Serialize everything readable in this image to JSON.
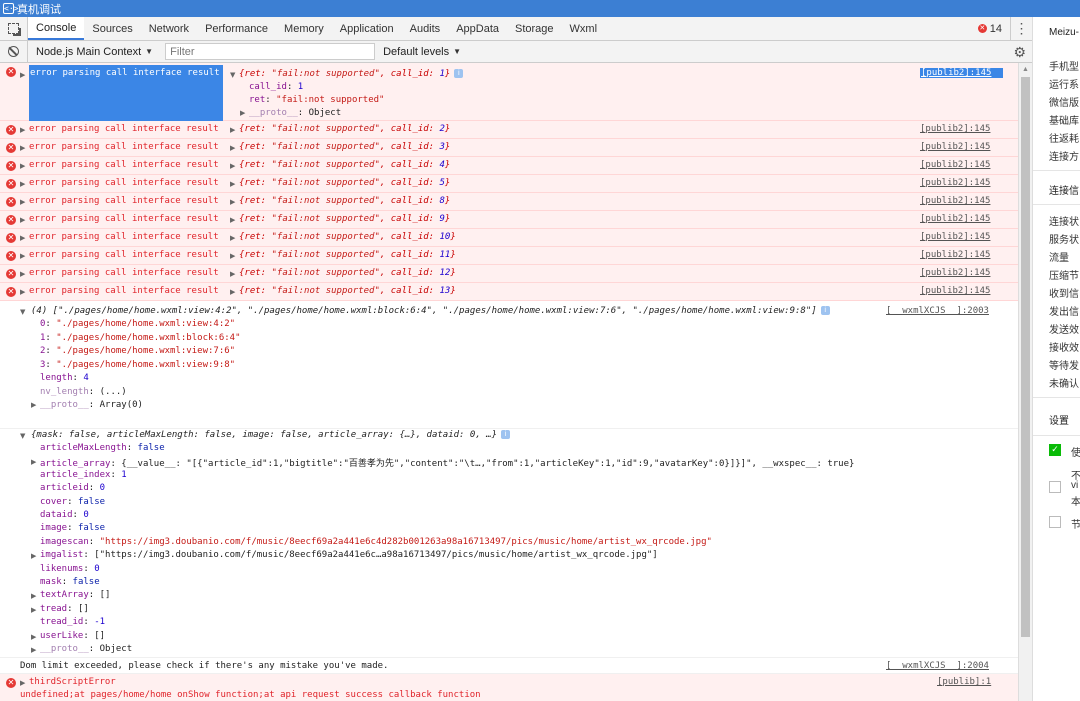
{
  "window": {
    "title": "真机调试",
    "icon": "<·>"
  },
  "tabs": [
    "Console",
    "Sources",
    "Network",
    "Performance",
    "Memory",
    "Application",
    "Audits",
    "AppData",
    "Storage",
    "Wxml"
  ],
  "error_count": "14",
  "filter": {
    "context": "Node.js Main Context",
    "placeholder": "Filter",
    "levels": "Default levels"
  },
  "errors": [
    {
      "msg": "error parsing call interface result",
      "ret": "\"fail:not supported\"",
      "call_id": "1",
      "source": "[publib2]:145"
    },
    {
      "msg": "error parsing call interface result",
      "ret": "\"fail:not supported\"",
      "call_id": "2",
      "source": "[publib2]:145"
    },
    {
      "msg": "error parsing call interface result",
      "ret": "\"fail:not supported\"",
      "call_id": "3",
      "source": "[publib2]:145"
    },
    {
      "msg": "error parsing call interface result",
      "ret": "\"fail:not supported\"",
      "call_id": "4",
      "source": "[publib2]:145"
    },
    {
      "msg": "error parsing call interface result",
      "ret": "\"fail:not supported\"",
      "call_id": "5",
      "source": "[publib2]:145"
    },
    {
      "msg": "error parsing call interface result",
      "ret": "\"fail:not supported\"",
      "call_id": "8",
      "source": "[publib2]:145"
    },
    {
      "msg": "error parsing call interface result",
      "ret": "\"fail:not supported\"",
      "call_id": "9",
      "source": "[publib2]:145"
    },
    {
      "msg": "error parsing call interface result",
      "ret": "\"fail:not supported\"",
      "call_id": "10",
      "source": "[publib2]:145"
    },
    {
      "msg": "error parsing call interface result",
      "ret": "\"fail:not supported\"",
      "call_id": "11",
      "source": "[publib2]:145"
    },
    {
      "msg": "error parsing call interface result",
      "ret": "\"fail:not supported\"",
      "call_id": "12",
      "source": "[publib2]:145"
    },
    {
      "msg": "error parsing call interface result",
      "ret": "\"fail:not supported\"",
      "call_id": "13",
      "source": "[publib2]:145"
    }
  ],
  "first_error_expanded": {
    "call_id_line": "1",
    "ret_line": "\"fail:not supported\"",
    "proto_line": "Object"
  },
  "array_log": {
    "summary": "(4) [\"./pages/home/home.wxml:view:4:2\", \"./pages/home/home.wxml:block:6:4\", \"./pages/home/home.wxml:view:7:6\", \"./pages/home/home.wxml:view:9:8\"]",
    "source": "[__wxmlXCJS__]:2003",
    "items": [
      {
        "key": "0",
        "value": "\"./pages/home/home.wxml:view:4:2\""
      },
      {
        "key": "1",
        "value": "\"./pages/home/home.wxml:block:6:4\""
      },
      {
        "key": "2",
        "value": "\"./pages/home/home.wxml:view:7:6\""
      },
      {
        "key": "3",
        "value": "\"./pages/home/home.wxml:view:9:8\""
      }
    ],
    "length": "4",
    "nv_length": "(...)",
    "proto": "Array(0)"
  },
  "object_log": {
    "summary": "{mask: false, articleMaxLength: false, image: false, article_array: {…}, dataid: 0, …}",
    "props": [
      {
        "expandable": false,
        "key": "articleMaxLength",
        "value": "false",
        "type": "b"
      },
      {
        "expandable": true,
        "key": "article_array",
        "value": "{__value__: \"[{\"article_id\":1,\"bigtitle\":\"百善孝为先\",\"content\":\"\\t…,\"from\":1,\"articleKey\":1,\"id\":9,\"avatarKey\":0}]}]\", __wxspec__: true}",
        "type": "p"
      },
      {
        "expandable": false,
        "key": "article_index",
        "value": "1",
        "type": "n"
      },
      {
        "expandable": false,
        "key": "articleid",
        "value": "0",
        "type": "n"
      },
      {
        "expandable": false,
        "key": "cover",
        "value": "false",
        "type": "b"
      },
      {
        "expandable": false,
        "key": "dataid",
        "value": "0",
        "type": "n"
      },
      {
        "expandable": false,
        "key": "image",
        "value": "false",
        "type": "b"
      },
      {
        "expandable": false,
        "key": "imagescan",
        "value": "\"https://img3.doubanio.com/f/music/8eecf69a2a441e6c4d282b001263a98a16713497/pics/music/home/artist_wx_qrcode.jpg\"",
        "type": "s"
      },
      {
        "expandable": true,
        "key": "imgalist",
        "value": "[\"https://img3.doubanio.com/f/music/8eecf69a2a441e6c…a98a16713497/pics/music/home/artist_wx_qrcode.jpg\"]",
        "type": "p"
      },
      {
        "expandable": false,
        "key": "likenums",
        "value": "0",
        "type": "n"
      },
      {
        "expandable": false,
        "key": "mask",
        "value": "false",
        "type": "b"
      },
      {
        "expandable": true,
        "key": "textArray",
        "value": "[]",
        "type": "p"
      },
      {
        "expandable": true,
        "key": "tread",
        "value": "[]",
        "type": "p"
      },
      {
        "expandable": false,
        "key": "tread_id",
        "value": "-1",
        "type": "n"
      },
      {
        "expandable": true,
        "key": "userLike",
        "value": "[]",
        "type": "p"
      },
      {
        "expandable": true,
        "key": "__proto__",
        "value": "Object",
        "type": "p"
      }
    ]
  },
  "dom_limit": {
    "text": "Dom limit exceeded, please check if there's any mistake you've made.",
    "source": "[__wxmlXCJS__]:2004"
  },
  "third_error": {
    "title": "thirdScriptError",
    "line1": "undefined;at pages/home/home onShow function;at api request success callback function",
    "line2": "undefined",
    "source": "[publib]:1"
  },
  "right_panel": {
    "device": "Meizu-",
    "info_items": [
      "手机型",
      "运行系",
      "微信版",
      "基础库",
      "往返耗",
      "连接方"
    ],
    "conn_header": "连接信",
    "conn_items": [
      "连接状",
      "服务状",
      "流量",
      "压缩节",
      "收到信",
      "发出信",
      "发送效",
      "接收效",
      "等待发",
      "未确认"
    ],
    "settings_header": "设置",
    "setting1": "使",
    "setting2_lines": [
      "不",
      "vi",
      "本"
    ],
    "setting3": "节"
  }
}
